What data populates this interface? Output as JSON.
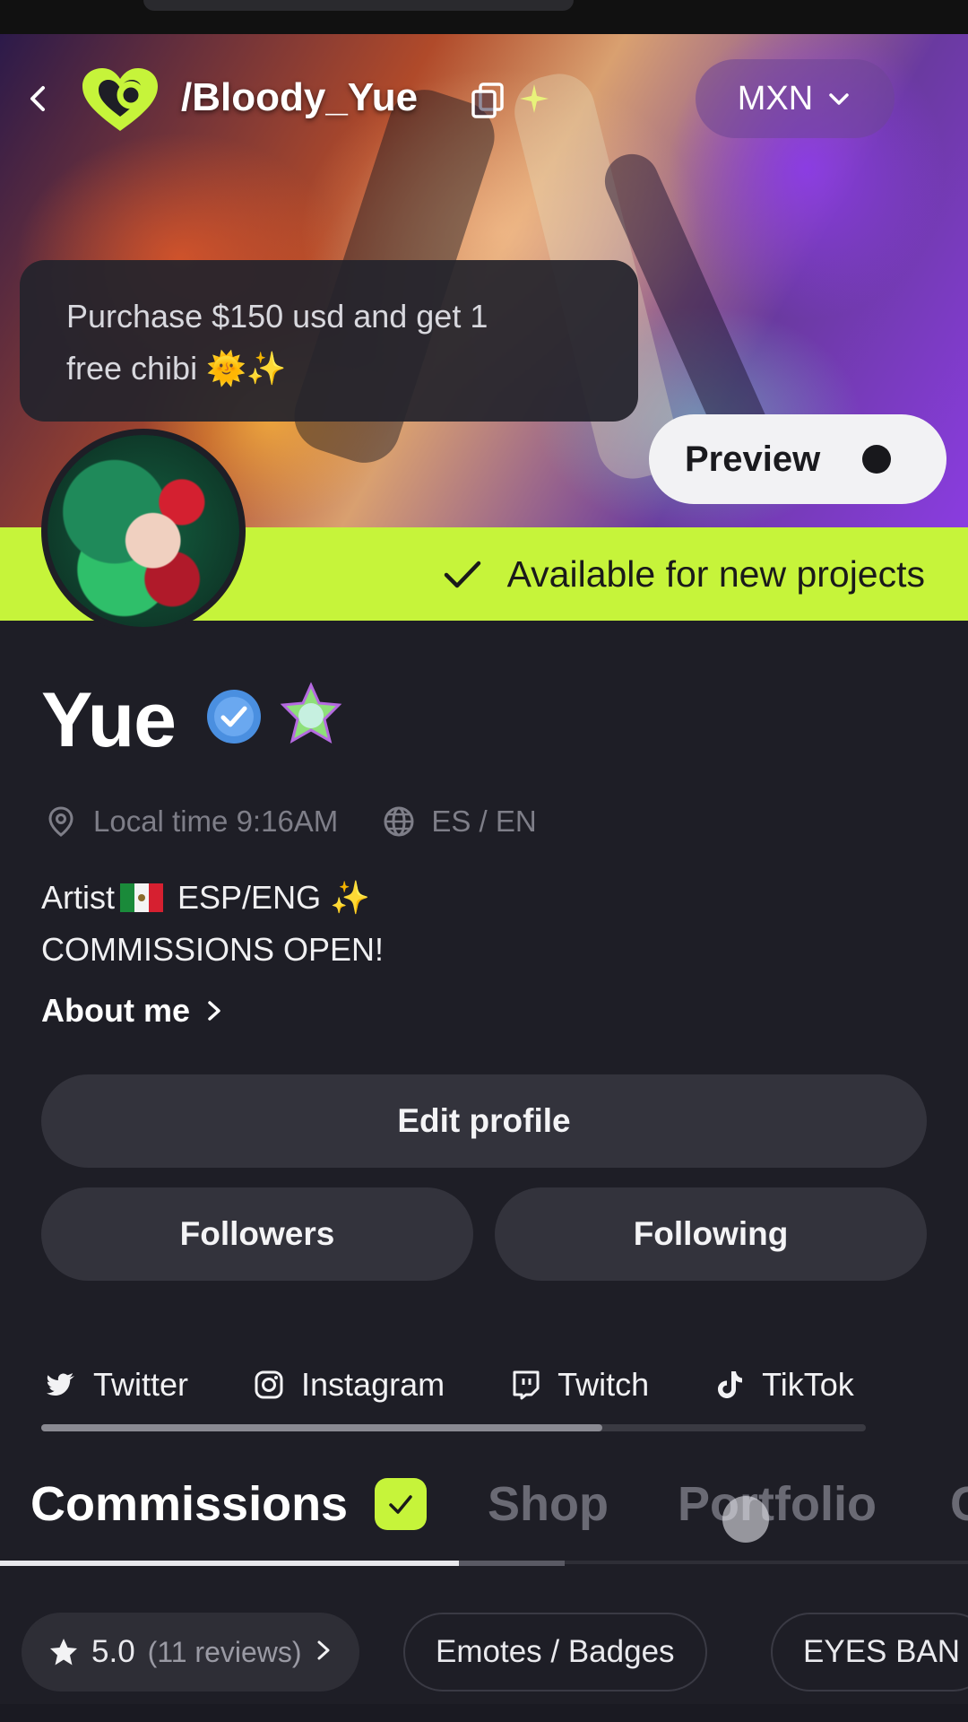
{
  "header": {
    "handle": "/Bloody_Yue",
    "currency": "MXN"
  },
  "promo": {
    "line1": "Purchase $150 usd and get 1",
    "line2": "free chibi 🌞✨"
  },
  "preview_label": "Preview",
  "availability": "Available for new projects",
  "profile": {
    "name": "Yue",
    "local_time": "Local time 9:16AM",
    "languages": "ES / EN",
    "bio_line1_a": "Artist",
    "bio_line1_b": " ESP/ENG ✨",
    "bio_line2": "COMMISSIONS OPEN!",
    "about_me": "About me"
  },
  "buttons": {
    "edit_profile": "Edit profile",
    "followers": "Followers",
    "following": "Following"
  },
  "socials": [
    {
      "label": "Twitter",
      "icon": "twitter-icon"
    },
    {
      "label": "Instagram",
      "icon": "instagram-icon"
    },
    {
      "label": "Twitch",
      "icon": "twitch-icon"
    },
    {
      "label": "TikTok",
      "icon": "tiktok-icon"
    }
  ],
  "social_scroll_fraction": 0.68,
  "tabs": [
    {
      "label": "Commissions",
      "active": true
    },
    {
      "label": "Shop",
      "active": false
    },
    {
      "label": "Portfolio",
      "active": false
    },
    {
      "label": "C",
      "active": false
    }
  ],
  "chips": {
    "rating": "5.0",
    "reviews": "(11 reviews)",
    "category1": "Emotes / Badges",
    "category2": "EYES BAN"
  },
  "colors": {
    "accent": "#c6f43a",
    "background": "#1e1e26",
    "button": "#33333c"
  }
}
